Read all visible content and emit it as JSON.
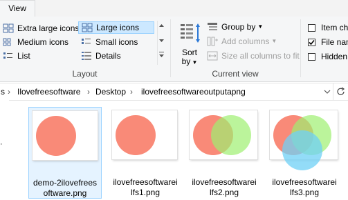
{
  "tabs": {
    "view": "View"
  },
  "layout": {
    "extra_large_icons": "Extra large icons",
    "large_icons": "Large icons",
    "medium_icons": "Medium icons",
    "small_icons": "Small icons",
    "list": "List",
    "details": "Details",
    "group_label": "Layout"
  },
  "current_view": {
    "sort_by_line1": "Sort",
    "sort_by_line2": "by",
    "group_by": "Group by",
    "add_columns": "Add columns",
    "size_all_columns": "Size all columns to fit",
    "group_label": "Current view"
  },
  "show_hide": {
    "item_checkboxes": "Item che",
    "file_name_extensions": "File nam",
    "hidden_items": "Hidden"
  },
  "address": {
    "leading": "s",
    "crumbs": [
      "Ilovefreesoftware",
      "Desktop",
      "ilovefreesoftwareoutputapng"
    ],
    "separator": "›"
  },
  "files": [
    {
      "name": "demo-2ilovefrees\noftware.png"
    },
    {
      "name": "ilovefreesoftwarei\nlfs1.png"
    },
    {
      "name": "ilovefreesoftwarei\nlfs2.png"
    },
    {
      "name": "ilovefreesoftwarei\nlfs3.png"
    }
  ],
  "colors": {
    "selected": "#cce8ff",
    "red_circle": "#f98a78",
    "green_circle": "#9ef070",
    "blue_circle": "#6fd0f5"
  }
}
